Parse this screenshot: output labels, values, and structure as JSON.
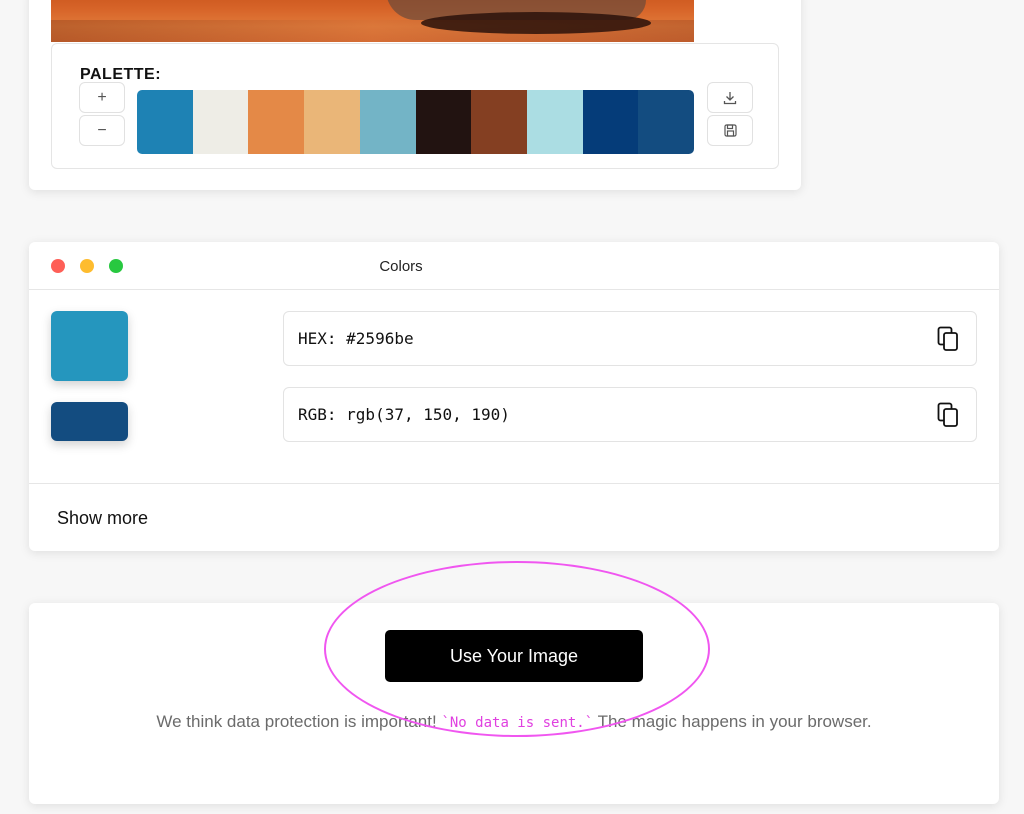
{
  "palette": {
    "title": "PALETTE:",
    "add_label": "+",
    "remove_label": "−",
    "colors": [
      "#1e82b4",
      "#eeede6",
      "#e48947",
      "#eab678",
      "#73b4c6",
      "#221311",
      "#843f22",
      "#abdde3",
      "#053c79",
      "#134c80"
    ]
  },
  "colors_panel": {
    "title": "Colors",
    "primary_swatch": "#2596be",
    "secondary_swatch": "#134c80",
    "hex_value": "HEX: #2596be",
    "rgb_value": "RGB: rgb(37, 150, 190)",
    "show_more": "Show more"
  },
  "cta": {
    "button_label": "Use Your Image",
    "note_before": "We think data protection is important! ",
    "note_code": "`No data is sent.`",
    "note_after": " The magic happens in your browser."
  }
}
